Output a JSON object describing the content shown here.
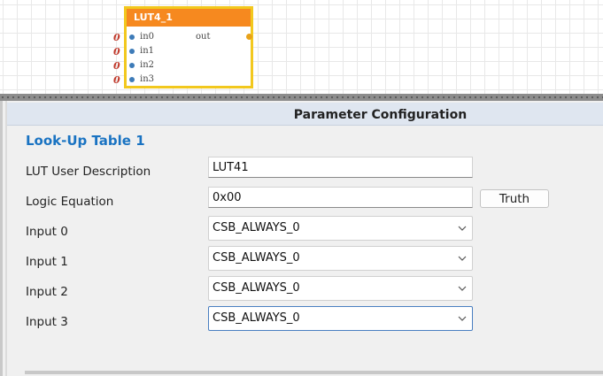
{
  "canvas": {
    "block": {
      "title": "LUT4_1",
      "inputs": [
        {
          "label": "in0",
          "value": "0"
        },
        {
          "label": "in1",
          "value": "0"
        },
        {
          "label": "in2",
          "value": "0"
        },
        {
          "label": "in3",
          "value": "0"
        }
      ],
      "output": {
        "label": "out"
      }
    }
  },
  "panel": {
    "header": "Parameter Configuration",
    "section_title": "Look-Up Table 1",
    "fields": {
      "lut_user_description": {
        "label": "LUT User Description",
        "value": "LUT41"
      },
      "logic_equation": {
        "label": "Logic Equation",
        "value": "0x00"
      },
      "truth_button": "Truth",
      "input0": {
        "label": "Input 0",
        "value": "CSB_ALWAYS_0"
      },
      "input1": {
        "label": "Input 1",
        "value": "CSB_ALWAYS_0"
      },
      "input2": {
        "label": "Input 2",
        "value": "CSB_ALWAYS_0"
      },
      "input3": {
        "label": "Input 3",
        "value": "CSB_ALWAYS_0"
      }
    }
  },
  "colors": {
    "block_header": "#f6891f",
    "block_border": "#f2c81e",
    "section_title": "#1a73c2",
    "pin_value": "#c0392b",
    "input_pin": "#3d7bb8",
    "output_pin": "#e8a21a"
  }
}
